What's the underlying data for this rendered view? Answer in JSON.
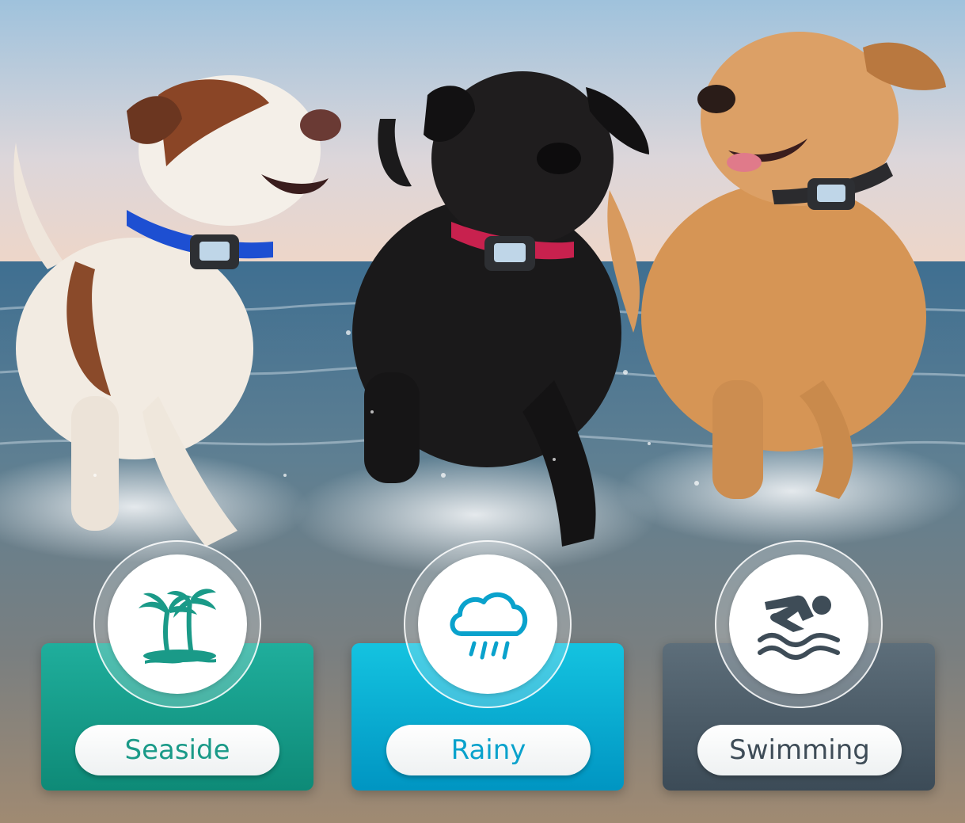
{
  "scene": {
    "subject": "three dogs running through shallow sea water, each wearing a collar with a digital display"
  },
  "badges": [
    {
      "label": "Seaside",
      "icon": "palm-island-icon",
      "color": "#1a9a88"
    },
    {
      "label": "Rainy",
      "icon": "rain-cloud-icon",
      "color": "#0aa2cc"
    },
    {
      "label": "Swimming",
      "icon": "swimmer-icon",
      "color": "#3e4c57"
    }
  ]
}
